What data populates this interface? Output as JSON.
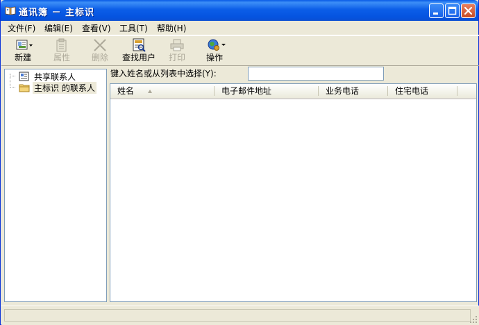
{
  "window": {
    "title": "通讯簿 － 主标识",
    "colors": {
      "titlebar": "#0554e0",
      "close_button": "#c64b24",
      "chrome": "#ece9d8"
    }
  },
  "menu": {
    "items": [
      {
        "label": "文件(F)"
      },
      {
        "label": "编辑(E)"
      },
      {
        "label": "查看(V)"
      },
      {
        "label": "工具(T)"
      },
      {
        "label": "帮助(H)"
      }
    ]
  },
  "toolbar": {
    "buttons": [
      {
        "label": "新建",
        "icon": "new-contact-icon",
        "enabled": true
      },
      {
        "label": "属性",
        "icon": "properties-icon",
        "enabled": false
      },
      {
        "label": "删除",
        "icon": "delete-icon",
        "enabled": false
      },
      {
        "label": "查找用户",
        "icon": "find-people-icon",
        "enabled": true
      },
      {
        "label": "打印",
        "icon": "print-icon",
        "enabled": false
      },
      {
        "label": "操作",
        "icon": "action-icon",
        "enabled": true
      }
    ]
  },
  "tree": {
    "items": [
      {
        "label": "共享联系人",
        "icon": "shared-contacts-icon",
        "selected": false
      },
      {
        "label": "主标识 的联系人",
        "icon": "folder-icon",
        "selected": true
      }
    ]
  },
  "search": {
    "label": "键入姓名或从列表中选择(Y):",
    "value": ""
  },
  "list": {
    "columns": [
      {
        "label": "姓名",
        "sorted": "ascending"
      },
      {
        "label": "电子邮件地址"
      },
      {
        "label": "业务电话"
      },
      {
        "label": "住宅电话"
      }
    ],
    "rows": []
  }
}
